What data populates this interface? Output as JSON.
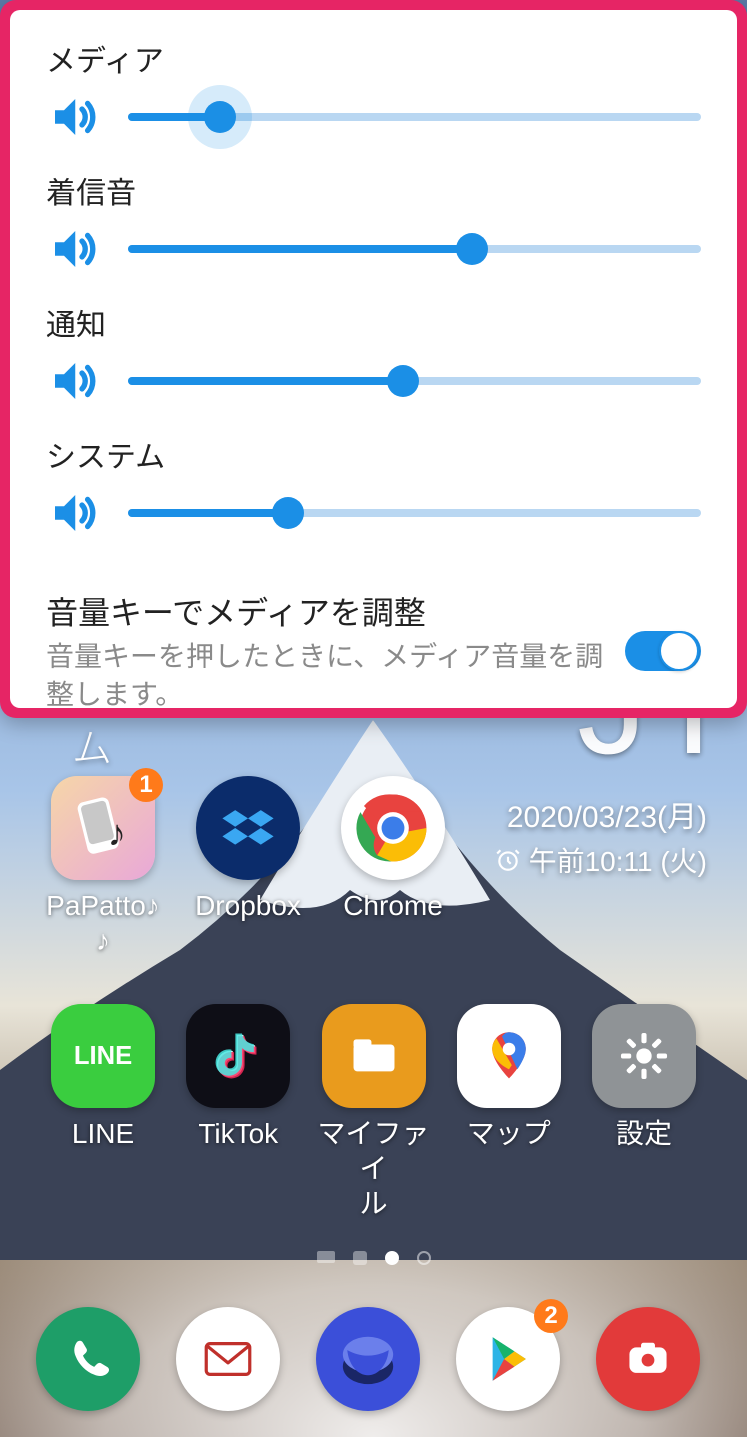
{
  "volume_panel": {
    "sliders": [
      {
        "label": "メディア",
        "value": 16,
        "halo": true
      },
      {
        "label": "着信音",
        "value": 60,
        "halo": false
      },
      {
        "label": "通知",
        "value": 48,
        "halo": false
      },
      {
        "label": "システム",
        "value": 28,
        "halo": false
      }
    ],
    "toggle": {
      "title": "音量キーでメディアを調整",
      "description": "音量キーを押したときに、メディア音量を調整します。",
      "on": true
    }
  },
  "home": {
    "peek_text": "ム",
    "clock": {
      "big_partial": "J I",
      "date": "2020/03/23(月)",
      "alarm": "午前10:11 (火)"
    },
    "row1": [
      {
        "name": "PaPatto♪♪",
        "label": "PaPatto♪\n♪",
        "icon": "papatto",
        "badge": "1"
      },
      {
        "name": "Dropbox",
        "label": "Dropbox",
        "icon": "dropbox"
      },
      {
        "name": "Chrome",
        "label": "Chrome",
        "icon": "chrome"
      }
    ],
    "row2": [
      {
        "name": "LINE",
        "label": "LINE",
        "icon": "line"
      },
      {
        "name": "TikTok",
        "label": "TikTok",
        "icon": "tiktok"
      },
      {
        "name": "マイファイル",
        "label": "マイファイ\nル",
        "icon": "files"
      },
      {
        "name": "マップ",
        "label": "マップ",
        "icon": "maps"
      },
      {
        "name": "設定",
        "label": "設定",
        "icon": "settings"
      }
    ],
    "dock": [
      {
        "name": "phone",
        "icon": "phone"
      },
      {
        "name": "mail",
        "icon": "mail"
      },
      {
        "name": "browser",
        "icon": "browser"
      },
      {
        "name": "play",
        "icon": "play",
        "badge": "2"
      },
      {
        "name": "camera",
        "icon": "camera"
      }
    ]
  }
}
